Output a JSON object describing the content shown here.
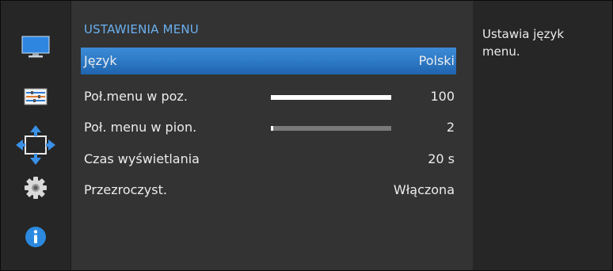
{
  "sidebar": {
    "icons": [
      "picture-icon",
      "adjust-icon",
      "osd-menu-icon",
      "settings-icon",
      "information-icon"
    ]
  },
  "menu": {
    "title": "USTAWIENIA MENU",
    "items": [
      {
        "label": "Język",
        "value": "Polski"
      },
      {
        "label": "Poł.menu w poz.",
        "value": "100",
        "level": 1.0
      },
      {
        "label": "Poł. menu w pion.",
        "value": "2",
        "level": 0.02
      },
      {
        "label": "Czas wyświetlania",
        "value": "20 s"
      },
      {
        "label": "Przezroczyst.",
        "value": "Włączona"
      }
    ]
  },
  "description": {
    "text": "Ustawia język menu."
  },
  "colors": {
    "accent": "#2f7cc8",
    "title": "#6ab0f0",
    "info": "#2b8ae0"
  }
}
